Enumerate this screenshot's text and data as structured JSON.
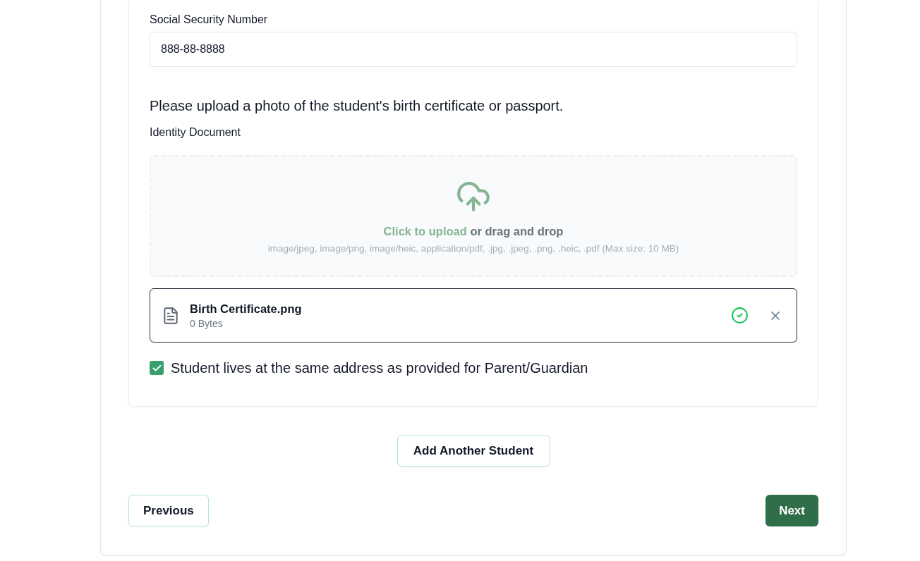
{
  "form": {
    "ssn": {
      "label": "Social Security Number",
      "value": "888-88-8888"
    },
    "upload_prompt": "Please upload a photo of the student's birth certificate or passport.",
    "identity_document": {
      "label": "Identity Document",
      "dropzone": {
        "link": "Click to upload",
        "text": "or drag and drop",
        "hint": "image/jpeg, image/png, image/heic, application/pdf, .jpg, .jpeg, .png, .heic, .pdf (Max size: 10 MB)"
      },
      "files": [
        {
          "name": "Birth Certificate.png",
          "size": "0 Bytes",
          "uploaded": true
        }
      ]
    },
    "same_address": {
      "label": "Student lives at the same address as provided for Parent/Guardian",
      "checked": true
    }
  },
  "add_student_button": "Add Another Student",
  "nav": {
    "previous": "Previous",
    "next": "Next"
  }
}
